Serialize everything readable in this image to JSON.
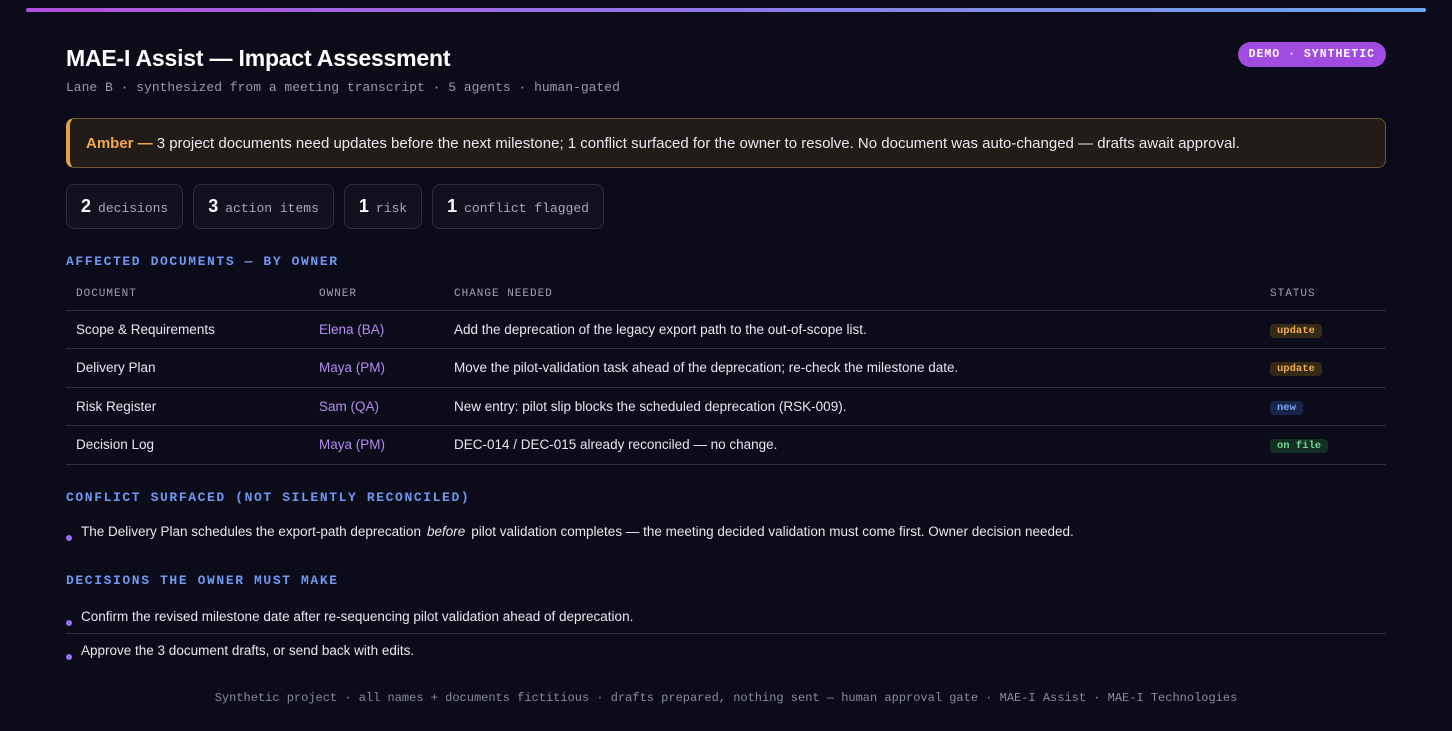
{
  "header": {
    "title": "MAE-I Assist — Impact Assessment",
    "subtitle": "Lane B · synthesized from a meeting transcript · 5 agents · human-gated",
    "badge": "DEMO · SYNTHETIC"
  },
  "alert": {
    "level": "Amber —",
    "message": "3 project documents need updates before the next milestone; 1 conflict surfaced for the owner to resolve. No document was auto-changed — drafts await approval.",
    "accent_color": "#e0a24a"
  },
  "stats": [
    {
      "value": "2",
      "label": "decisions"
    },
    {
      "value": "3",
      "label": "action items"
    },
    {
      "value": "1",
      "label": "risk"
    },
    {
      "value": "1",
      "label": "conflict flagged"
    }
  ],
  "affected": {
    "heading": "AFFECTED DOCUMENTS — BY OWNER",
    "columns": [
      "DOCUMENT",
      "OWNER",
      "CHANGE NEEDED",
      "STATUS"
    ],
    "rows": [
      {
        "document": "Scope & Requirements",
        "owner": "Elena (BA)",
        "change": "Add the deprecation of the legacy export path to the out-of-scope list.",
        "status": "update"
      },
      {
        "document": "Delivery Plan",
        "owner": "Maya (PM)",
        "change": "Move the pilot-validation task ahead of the deprecation; re-check the milestone date.",
        "status": "update"
      },
      {
        "document": "Risk Register",
        "owner": "Sam (QA)",
        "change": "New entry: pilot slip blocks the scheduled deprecation (RSK-009).",
        "status": "new"
      },
      {
        "document": "Decision Log",
        "owner": "Maya (PM)",
        "change": "DEC-014 / DEC-015 already reconciled — no change.",
        "status": "on file"
      }
    ]
  },
  "conflict": {
    "heading": "CONFLICT SURFACED (NOT SILENTLY RECONCILED)",
    "text_before": "The Delivery Plan schedules the export-path deprecation",
    "emphasis": "before",
    "text_after": "pilot validation completes — the meeting decided validation must come first. Owner decision needed."
  },
  "decisions": {
    "heading": "DECISIONS THE OWNER MUST MAKE",
    "items": [
      "Confirm the revised milestone date after re-sequencing pilot validation ahead of deprecation.",
      "Approve the 3 document drafts, or send back with edits."
    ]
  },
  "footer": "Synthetic project · all names + documents fictitious · drafts prepared, nothing sent — human approval gate · MAE-I Assist · MAE-I Technologies",
  "colors": {
    "background": "#0b0b19",
    "accent_purple": "#a24be0",
    "section_blue": "#6f98f0",
    "owner_purple": "#b48cf0",
    "amber": "#f0a94f",
    "status_update": "#f0a94f",
    "status_new": "#7aa4f4",
    "status_on_file": "#6fd69a"
  }
}
